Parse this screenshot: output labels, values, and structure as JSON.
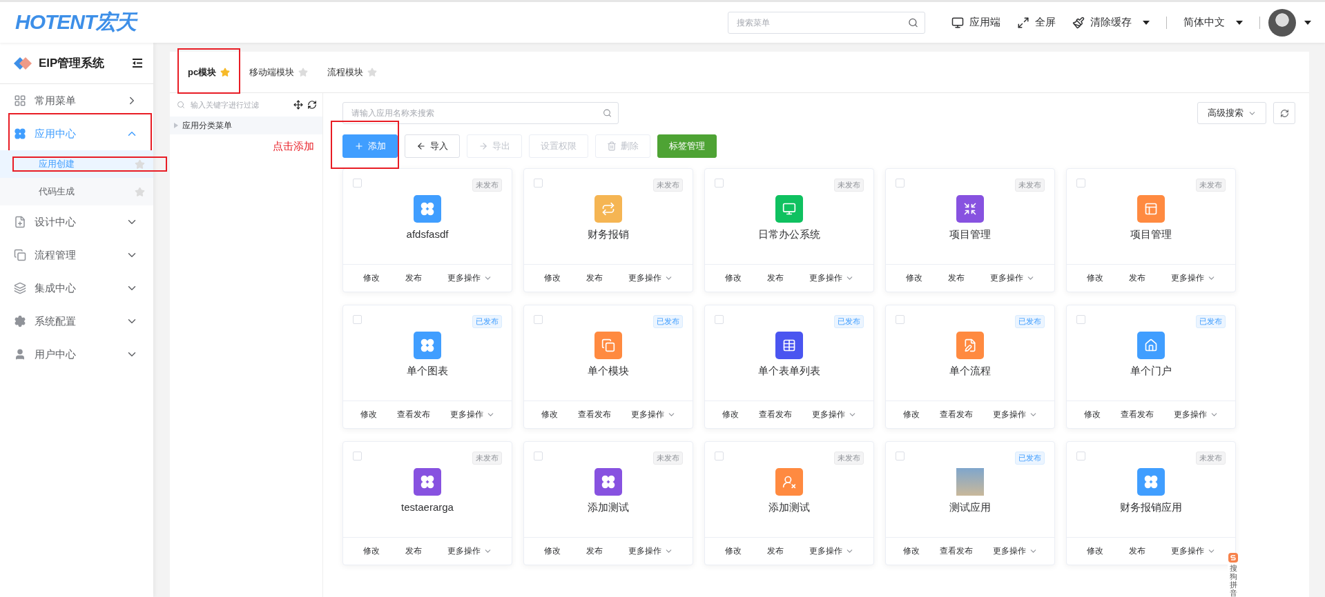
{
  "header": {
    "logo": "HOTENT宏天",
    "search": {
      "placeholder": "搜索菜单"
    },
    "actions": [
      {
        "kind": "monitor",
        "label": "应用端",
        "dropdown": false
      },
      {
        "kind": "fullscreen",
        "label": "全屏",
        "dropdown": false
      },
      {
        "kind": "brush",
        "label": "清除缓存",
        "dropdown": true
      }
    ],
    "language": "简体中文"
  },
  "sidebar": {
    "title": "EIP管理系统",
    "items": [
      {
        "kind": "shortcut",
        "label": "常用菜单",
        "expanded": false,
        "selected": false,
        "highlighted": false
      },
      {
        "kind": "group",
        "label": "应用中心",
        "expanded": true,
        "selected": true,
        "highlighted": true,
        "children": [
          {
            "label": "应用创建",
            "selected": true,
            "starred": false,
            "highlighted": true
          },
          {
            "label": "代码生成",
            "selected": false,
            "starred": false,
            "highlighted": false
          }
        ]
      },
      {
        "kind": "group",
        "label": "设计中心",
        "expanded": false,
        "selected": false,
        "highlighted": false
      },
      {
        "kind": "group",
        "label": "流程管理",
        "expanded": false,
        "selected": false,
        "highlighted": false
      },
      {
        "kind": "group",
        "label": "集成中心",
        "expanded": false,
        "selected": false,
        "highlighted": false
      },
      {
        "kind": "group",
        "label": "系统配置",
        "expanded": false,
        "selected": false,
        "highlighted": false
      },
      {
        "kind": "group",
        "label": "用户中心",
        "expanded": false,
        "selected": false,
        "highlighted": false
      }
    ]
  },
  "tabs": [
    {
      "label": "pc模块",
      "selected": true,
      "starred": true,
      "highlighted": true
    },
    {
      "label": "移动端模块",
      "selected": false,
      "starred": false,
      "highlighted": false
    },
    {
      "label": "流程模块",
      "selected": false,
      "starred": false,
      "highlighted": false
    }
  ],
  "tree": {
    "filter": {
      "placeholder": "输入关键字进行过滤"
    },
    "nodes": [
      {
        "label": "应用分类菜单",
        "expanded": false
      }
    ],
    "note": "点击添加"
  },
  "toolbar": {
    "search": {
      "placeholder": "请输入应用名称来搜索"
    },
    "advanced": "高级搜索",
    "buttons": [
      {
        "kind": "primary",
        "label": "添加",
        "disabled": false,
        "highlighted": true
      },
      {
        "kind": "default",
        "label": "导入",
        "disabled": false,
        "highlighted": false
      },
      {
        "kind": "default",
        "label": "导出",
        "disabled": true,
        "highlighted": false
      },
      {
        "kind": "default",
        "label": "设置权限",
        "disabled": true,
        "highlighted": false
      },
      {
        "kind": "default",
        "label": "删除",
        "disabled": true,
        "highlighted": false
      },
      {
        "kind": "success",
        "label": "标签管理",
        "disabled": false,
        "highlighted": false
      }
    ]
  },
  "apps": [
    {
      "name": "afdsfasdf",
      "kind": "clover",
      "color": "#409eff",
      "status": "未发布",
      "published": false,
      "checked": false,
      "actions": [
        "修改",
        "发布",
        "更多操作"
      ]
    },
    {
      "name": "财务报销",
      "kind": "repeat",
      "color": "#f5b553",
      "status": "未发布",
      "published": false,
      "checked": false,
      "actions": [
        "修改",
        "发布",
        "更多操作"
      ]
    },
    {
      "name": "日常办公系统",
      "kind": "monitor",
      "color": "#0fc160",
      "status": "未发布",
      "published": false,
      "checked": false,
      "actions": [
        "修改",
        "发布",
        "更多操作"
      ]
    },
    {
      "name": "项目管理",
      "kind": "shrink",
      "color": "#8752e0",
      "status": "未发布",
      "published": false,
      "checked": false,
      "actions": [
        "修改",
        "发布",
        "更多操作"
      ]
    },
    {
      "name": "项目管理",
      "kind": "layout",
      "color": "#ff8a40",
      "status": "未发布",
      "published": false,
      "checked": false,
      "actions": [
        "修改",
        "发布",
        "更多操作"
      ]
    },
    {
      "name": "单个图表",
      "kind": "clover",
      "color": "#409eff",
      "status": "已发布",
      "published": true,
      "checked": false,
      "actions": [
        "修改",
        "查看发布",
        "更多操作"
      ]
    },
    {
      "name": "单个模块",
      "kind": "copy",
      "color": "#ff8a40",
      "status": "已发布",
      "published": true,
      "checked": false,
      "actions": [
        "修改",
        "查看发布",
        "更多操作"
      ]
    },
    {
      "name": "单个表单列表",
      "kind": "table",
      "color": "#4a55f0",
      "status": "已发布",
      "published": true,
      "checked": false,
      "actions": [
        "修改",
        "查看发布",
        "更多操作"
      ]
    },
    {
      "name": "单个流程",
      "kind": "edit",
      "color": "#ff8a40",
      "status": "已发布",
      "published": true,
      "checked": false,
      "actions": [
        "修改",
        "查看发布",
        "更多操作"
      ]
    },
    {
      "name": "单个门户",
      "kind": "home",
      "color": "#409eff",
      "status": "已发布",
      "published": true,
      "checked": false,
      "actions": [
        "修改",
        "查看发布",
        "更多操作"
      ]
    },
    {
      "name": "testaerarga",
      "kind": "clover",
      "color": "#8752e0",
      "status": "未发布",
      "published": false,
      "checked": false,
      "actions": [
        "修改",
        "发布",
        "更多操作"
      ]
    },
    {
      "name": "添加测试",
      "kind": "clover",
      "color": "#8752e0",
      "status": "未发布",
      "published": false,
      "checked": false,
      "actions": [
        "修改",
        "发布",
        "更多操作"
      ]
    },
    {
      "name": "添加测试",
      "kind": "user-block",
      "color": "#ff8a40",
      "status": "未发布",
      "published": false,
      "checked": false,
      "actions": [
        "修改",
        "发布",
        "更多操作"
      ]
    },
    {
      "name": "测试应用",
      "kind": "photo",
      "status": "已发布",
      "published": true,
      "checked": false,
      "actions": [
        "修改",
        "查看发布",
        "更多操作"
      ]
    },
    {
      "name": "财务报销应用",
      "kind": "clover",
      "color": "#409eff",
      "status": "未发布",
      "published": false,
      "checked": false,
      "actions": [
        "修改",
        "发布",
        "更多操作"
      ]
    }
  ],
  "ime_widget": {
    "label": "搜狗拼音"
  }
}
